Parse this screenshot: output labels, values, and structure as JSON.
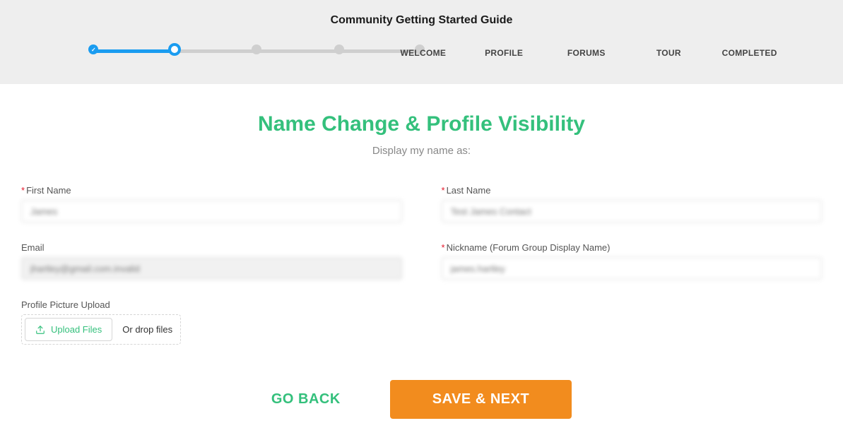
{
  "header": {
    "title": "Community Getting Started Guide",
    "steps": [
      {
        "label": "WELCOME",
        "state": "done"
      },
      {
        "label": "PROFILE",
        "state": "current"
      },
      {
        "label": "FORUMS",
        "state": "pending"
      },
      {
        "label": "TOUR",
        "state": "pending"
      },
      {
        "label": "COMPLETED",
        "state": "pending"
      }
    ]
  },
  "main": {
    "title": "Name Change & Profile Visibility",
    "subtitle": "Display my name as:"
  },
  "form": {
    "firstName": {
      "label": "First Name",
      "required": true,
      "value": "James"
    },
    "lastName": {
      "label": "Last Name",
      "required": true,
      "value": "Test James Contact"
    },
    "email": {
      "label": "Email",
      "required": false,
      "value": "jhartley@gmail.com.invalid",
      "disabled": true
    },
    "nickname": {
      "label": "Nickname (Forum Group Display Name)",
      "required": true,
      "value": "james.hartley"
    },
    "upload": {
      "label": "Profile Picture Upload",
      "button": "Upload Files",
      "dropText": "Or drop files"
    }
  },
  "actions": {
    "back": "GO BACK",
    "next": "SAVE & NEXT"
  },
  "colors": {
    "accent_green": "#34c07c",
    "accent_orange": "#f28c1e",
    "stepper_blue": "#1a9cf0",
    "error_red": "#e5172a"
  }
}
